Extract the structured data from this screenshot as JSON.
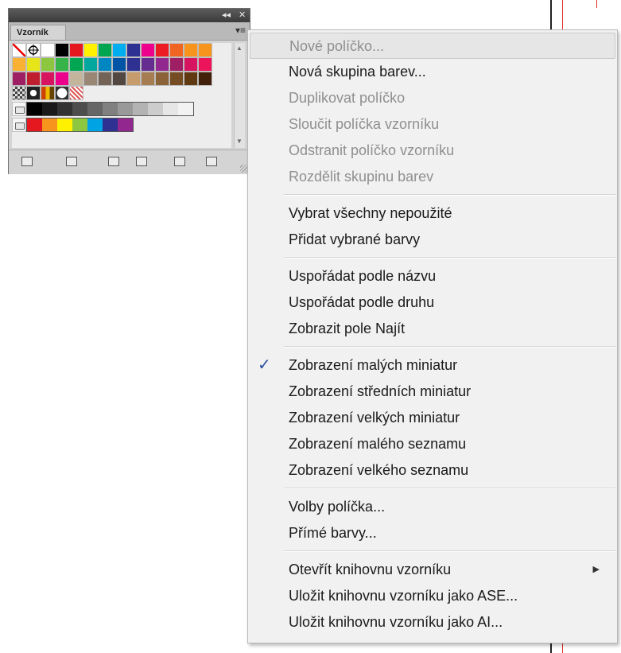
{
  "panel": {
    "titlebar_controls": {
      "collapse": "◂◂",
      "close": "✕"
    },
    "tab_label": "Vzorník",
    "menu_icon": "panel-menu-icon",
    "swatch_rows": [
      [
        "none",
        "registration",
        "#ffffff",
        "#000000",
        "#e6181f",
        "#fff100",
        "#00a54f",
        "#00adee",
        "#2e3092",
        "#ec008c",
        "#ed1c24",
        "#f16522",
        "#f7941d",
        "#f7941d"
      ],
      [
        "#f8b133",
        "#e7e51a",
        "#8dc63f",
        "#36b449",
        "#00a651",
        "#00a79d",
        "#0087c1",
        "#0054a5",
        "#2e3192",
        "#662d91",
        "#92278f",
        "#9e1f63",
        "#d6145f",
        "#ec145b"
      ],
      [
        "#9e1f63",
        "#be1e2d",
        "#d6145f",
        "#ec008c",
        "#c2b59b",
        "#998675",
        "#736357",
        "#534741",
        "#c69c6d",
        "#a67c52",
        "#8c6239",
        "#754c24",
        "#603913",
        "#42210b"
      ]
    ],
    "pattern_row": [
      "pattern-checker",
      "pattern-circle",
      "pattern-stripes",
      "pattern-dot",
      "pattern-wave"
    ],
    "gray_group": [
      "#000000",
      "#1a1a1a",
      "#333333",
      "#4d4d4d",
      "#666666",
      "#808080",
      "#999999",
      "#b3b3b3",
      "#cccccc",
      "#e6e6e6",
      "#f2f2f2"
    ],
    "color_group": [
      "#e6181f",
      "#f7941d",
      "#fff100",
      "#8dc63f",
      "#00a4e4",
      "#2e3092",
      "#92278f"
    ],
    "footer_icons": [
      "swatch-libraries-menu-icon",
      "show-swatch-kinds-icon",
      "swatch-options-icon",
      "new-color-group-icon",
      "new-swatch-icon",
      "delete-swatch-icon"
    ]
  },
  "menu": {
    "items": [
      {
        "label": "Nové políčko...",
        "disabled": true
      },
      {
        "label": "Nová skupina barev...",
        "disabled": false
      },
      {
        "label": "Duplikovat políčko",
        "disabled": true
      },
      {
        "label": "Sloučit políčka vzorníku",
        "disabled": true
      },
      {
        "label": "Odstranit políčko vzorníku",
        "disabled": true
      },
      {
        "label": "Rozdělit skupinu barev",
        "disabled": true
      },
      {
        "label": "Vybrat všechny nepoužité",
        "disabled": false
      },
      {
        "label": "Přidat vybrané barvy",
        "disabled": false
      },
      {
        "label": "Uspořádat podle názvu",
        "disabled": false
      },
      {
        "label": "Uspořádat podle druhu",
        "disabled": false
      },
      {
        "label": "Zobrazit pole Najít",
        "disabled": false
      },
      {
        "label": "Zobrazení malých miniatur",
        "disabled": false,
        "checked": true
      },
      {
        "label": "Zobrazení středních miniatur",
        "disabled": false
      },
      {
        "label": "Zobrazení velkých miniatur",
        "disabled": false
      },
      {
        "label": "Zobrazení malého seznamu",
        "disabled": false
      },
      {
        "label": "Zobrazení velkého seznamu",
        "disabled": false
      },
      {
        "label": "Volby políčka...",
        "disabled": false
      },
      {
        "label": "Přímé barvy...",
        "disabled": false
      },
      {
        "label": "Otevřít knihovnu vzorníku",
        "disabled": false,
        "submenu": true
      },
      {
        "label": "Uložit knihovnu vzorníku jako ASE...",
        "disabled": false
      },
      {
        "label": "Uložit knihovnu vzorníku jako AI...",
        "disabled": false
      }
    ],
    "check_mark": "✓",
    "submenu_arrow": "▶"
  }
}
